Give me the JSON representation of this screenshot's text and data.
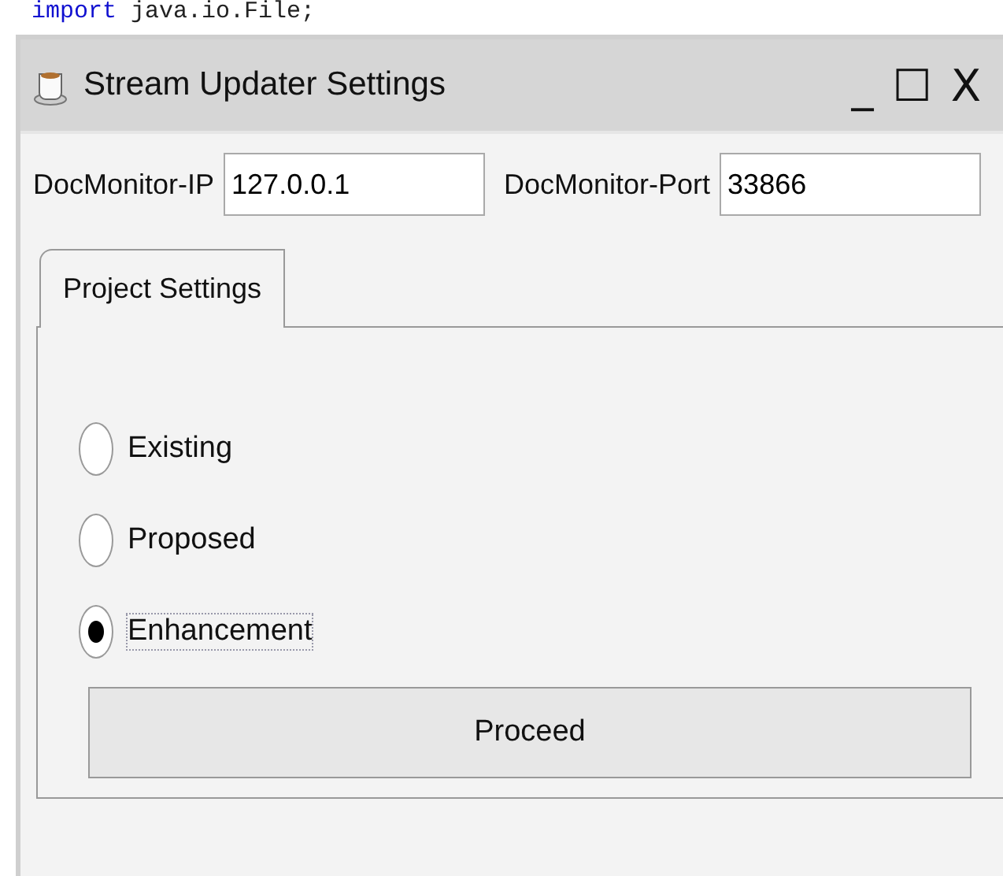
{
  "background_code": "import java.io.File;",
  "window": {
    "title": "Stream Updater Settings",
    "controls": [
      "_",
      "☐",
      "X"
    ]
  },
  "fields": [
    {
      "label": "DocMonitor-IP",
      "value": "127.0.0.1"
    },
    {
      "label": "DocMonitor-Port",
      "value": "33866"
    }
  ],
  "tabs": [
    {
      "label": "Project Settings",
      "selected": true
    }
  ],
  "radios": [
    {
      "label": "Existing",
      "selected": false
    },
    {
      "label": "Proposed",
      "selected": false
    },
    {
      "label": "Enhancement",
      "selected": true
    }
  ],
  "button": "Proceed"
}
